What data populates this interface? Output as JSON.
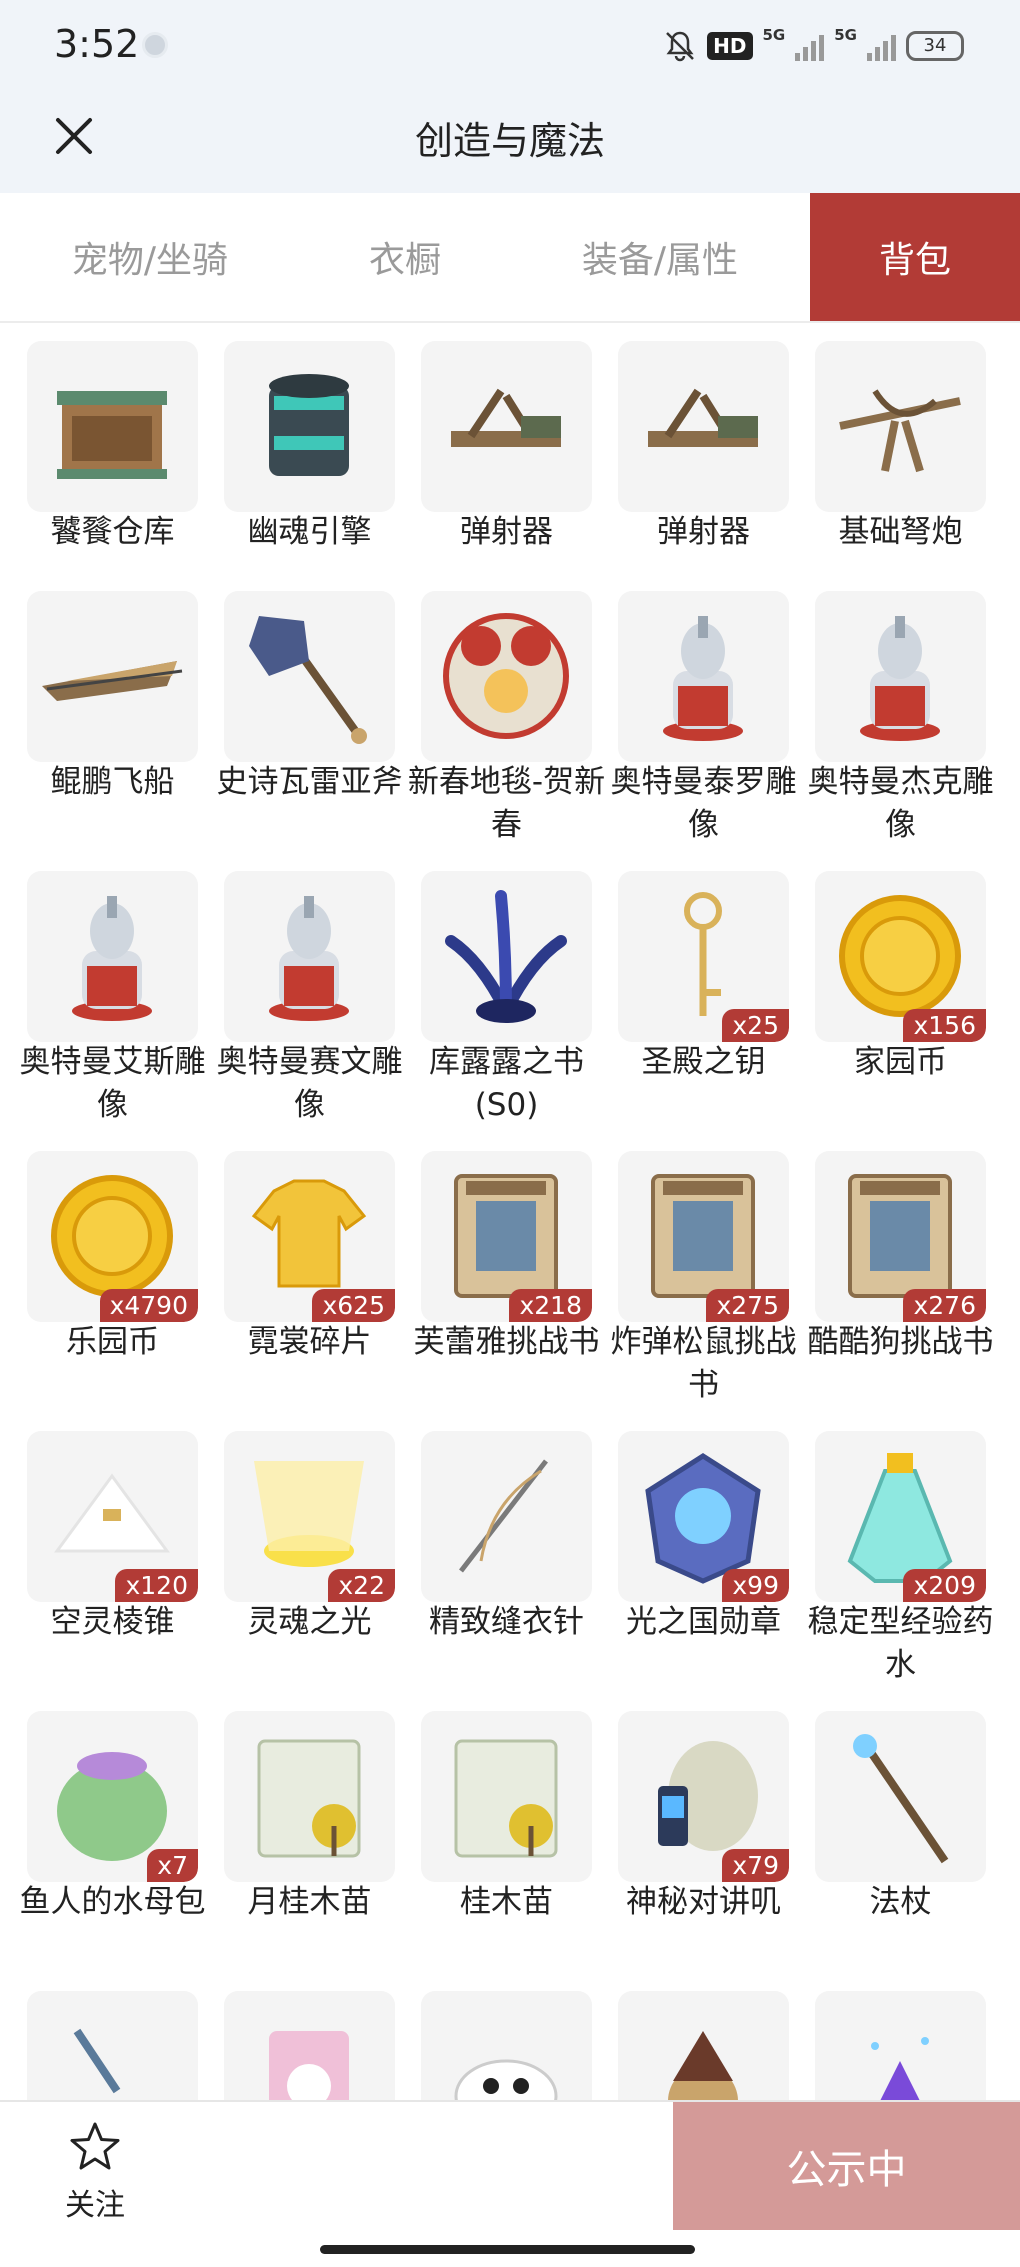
{
  "status_bar": {
    "time": "3:52",
    "hd": "HD",
    "net1": "5G",
    "net2": "5G",
    "battery": "34"
  },
  "header": {
    "title": "创造与魔法"
  },
  "tabs": [
    {
      "label": "宠物/坐骑",
      "active": false
    },
    {
      "label": "衣橱",
      "active": false
    },
    {
      "label": "装备/属性",
      "active": false
    },
    {
      "label": "背包",
      "active": true
    }
  ],
  "items": [
    {
      "name": "饕餮仓库",
      "count": "",
      "icon": "warehouse-icon"
    },
    {
      "name": "幽魂引擎",
      "count": "",
      "icon": "engine-icon"
    },
    {
      "name": "弹射器",
      "count": "",
      "icon": "catapult-icon"
    },
    {
      "name": "弹射器",
      "count": "",
      "icon": "catapult-icon"
    },
    {
      "name": "基础弩炮",
      "count": "",
      "icon": "ballista-icon"
    },
    {
      "name": "鲲鹏飞船",
      "count": "",
      "icon": "airship-icon"
    },
    {
      "name": "史诗瓦雷亚斧",
      "count": "",
      "icon": "axe-icon"
    },
    {
      "name": "新春地毯-贺新春",
      "count": "",
      "icon": "carpet-icon"
    },
    {
      "name": "奥特曼泰罗雕像",
      "count": "",
      "icon": "statue-icon"
    },
    {
      "name": "奥特曼杰克雕像",
      "count": "",
      "icon": "statue-icon"
    },
    {
      "name": "奥特曼艾斯雕像",
      "count": "",
      "icon": "statue-icon"
    },
    {
      "name": "奥特曼赛文雕像",
      "count": "",
      "icon": "statue-icon"
    },
    {
      "name": "库露露之书(S0)",
      "count": "",
      "icon": "tentacle-icon"
    },
    {
      "name": "圣殿之钥",
      "count": "x25",
      "icon": "key-icon"
    },
    {
      "name": "家园币",
      "count": "x156",
      "icon": "coin-icon"
    },
    {
      "name": "乐园币",
      "count": "x4790",
      "icon": "coin-icon"
    },
    {
      "name": "霓裳碎片",
      "count": "x625",
      "icon": "shirt-icon"
    },
    {
      "name": "芙蕾雅挑战书",
      "count": "x218",
      "icon": "wanted-poster-icon"
    },
    {
      "name": "炸弹松鼠挑战书",
      "count": "x275",
      "icon": "wanted-poster-icon"
    },
    {
      "name": "酷酷狗挑战书",
      "count": "x276",
      "icon": "wanted-poster-icon"
    },
    {
      "name": "空灵棱锥",
      "count": "x120",
      "icon": "pyramid-icon"
    },
    {
      "name": "灵魂之光",
      "count": "x22",
      "icon": "light-icon"
    },
    {
      "name": "精致缝衣针",
      "count": "",
      "icon": "needle-icon"
    },
    {
      "name": "光之国勋章",
      "count": "x99",
      "icon": "medal-icon"
    },
    {
      "name": "稳定型经验药水",
      "count": "x209",
      "icon": "potion-icon"
    },
    {
      "name": "鱼人的水母包",
      "count": "x7",
      "icon": "bag-icon"
    },
    {
      "name": "月桂木苗",
      "count": "",
      "icon": "seed-packet-icon"
    },
    {
      "name": "桂木苗",
      "count": "",
      "icon": "seed-packet-icon"
    },
    {
      "name": "神秘对讲叽",
      "count": "x79",
      "icon": "walkie-talkie-icon"
    },
    {
      "name": "法杖",
      "count": "",
      "icon": "staff-icon"
    },
    {
      "name": "",
      "count": "",
      "icon": "spear-icon"
    },
    {
      "name": "",
      "count": "",
      "icon": "snack-icon"
    },
    {
      "name": "",
      "count": "",
      "icon": "panda-icon"
    },
    {
      "name": "",
      "count": "",
      "icon": "wizard-icon"
    },
    {
      "name": "",
      "count": "",
      "icon": "crystal-icon"
    }
  ],
  "bottom": {
    "follow_label": "关注",
    "public_label": "公示中"
  },
  "colors": {
    "accent": "#b23b36",
    "public_button": "#d49a98",
    "header_bg": "#f0f4f9"
  }
}
